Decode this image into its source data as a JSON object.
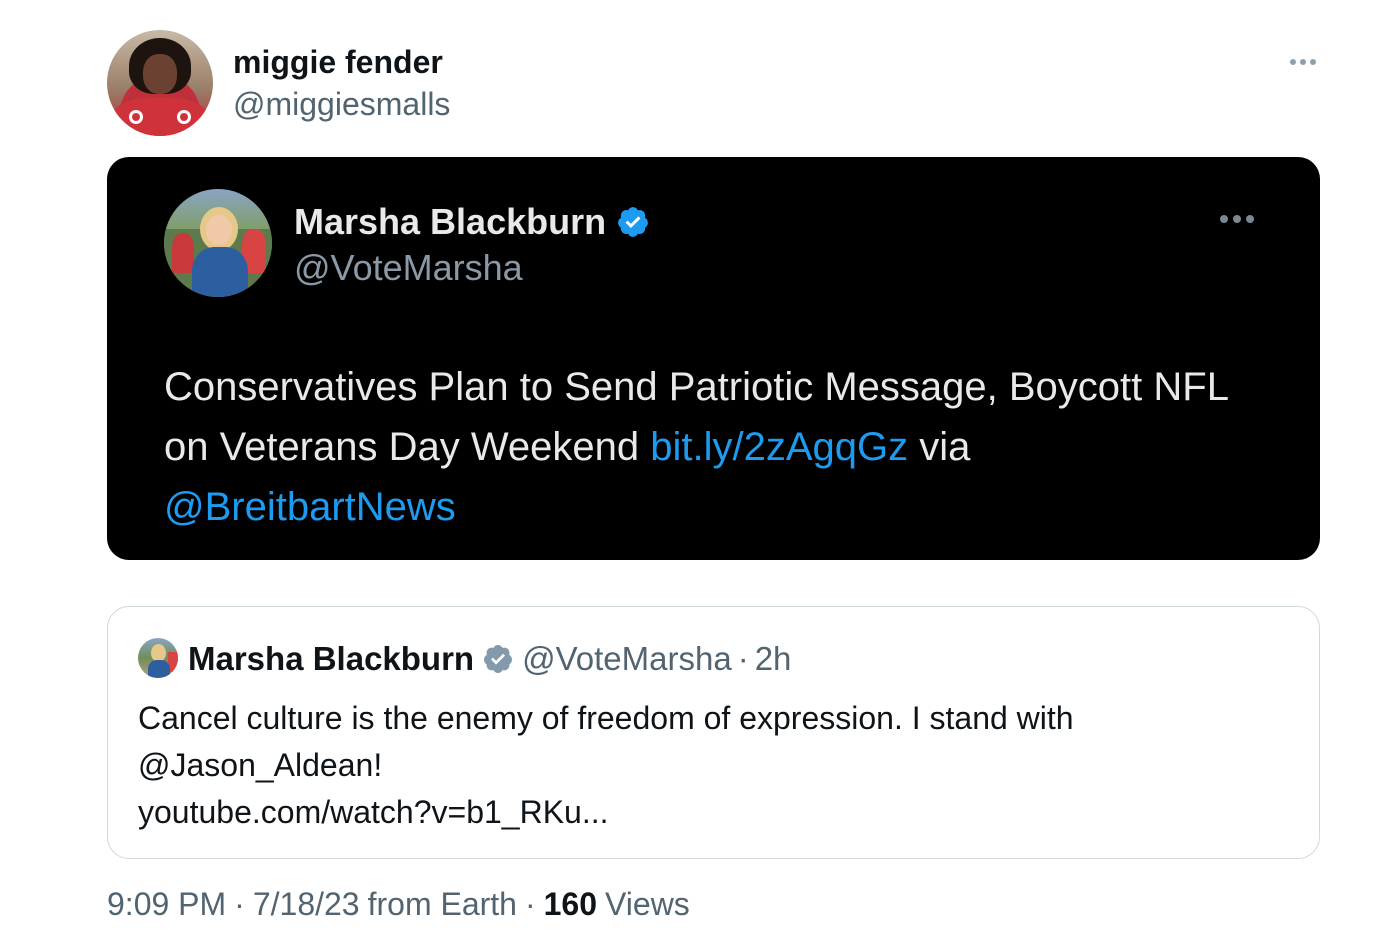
{
  "tweet": {
    "author_name": "miggie fender",
    "author_handle": "@miggiesmalls",
    "more_icon": "more-horizontal-icon",
    "time": "9:09 PM",
    "date": "7/18/23",
    "source": "from Earth",
    "separator": "·",
    "views_count": "160",
    "views_label": "Views"
  },
  "embedded_image": {
    "author_name": "Marsha Blackburn",
    "author_handle": "@VoteMarsha",
    "verified_icon": "verified-badge-icon",
    "text_before": "Conservatives Plan to Send Patriotic Message, Boycott NFL on Veterans Day Weekend ",
    "link": "bit.ly/2zAgqGz",
    "text_middle": " via ",
    "mention": "@BreitbartNews"
  },
  "quoted_tweet": {
    "author_name": "Marsha Blackburn",
    "author_handle": "@VoteMarsha",
    "separator": "·",
    "time_ago": "2h",
    "text_line1": "Cancel culture is the enemy of freedom of expression. I stand with",
    "text_line2": "@Jason_Aldean!",
    "text_line3": "youtube.com/watch?v=b1_RKu..."
  },
  "colors": {
    "link_blue": "#1d9bf0",
    "verified_blue": "#1d9bf0",
    "secondary_gray": "#536471",
    "dark_card_bg": "#000000"
  }
}
